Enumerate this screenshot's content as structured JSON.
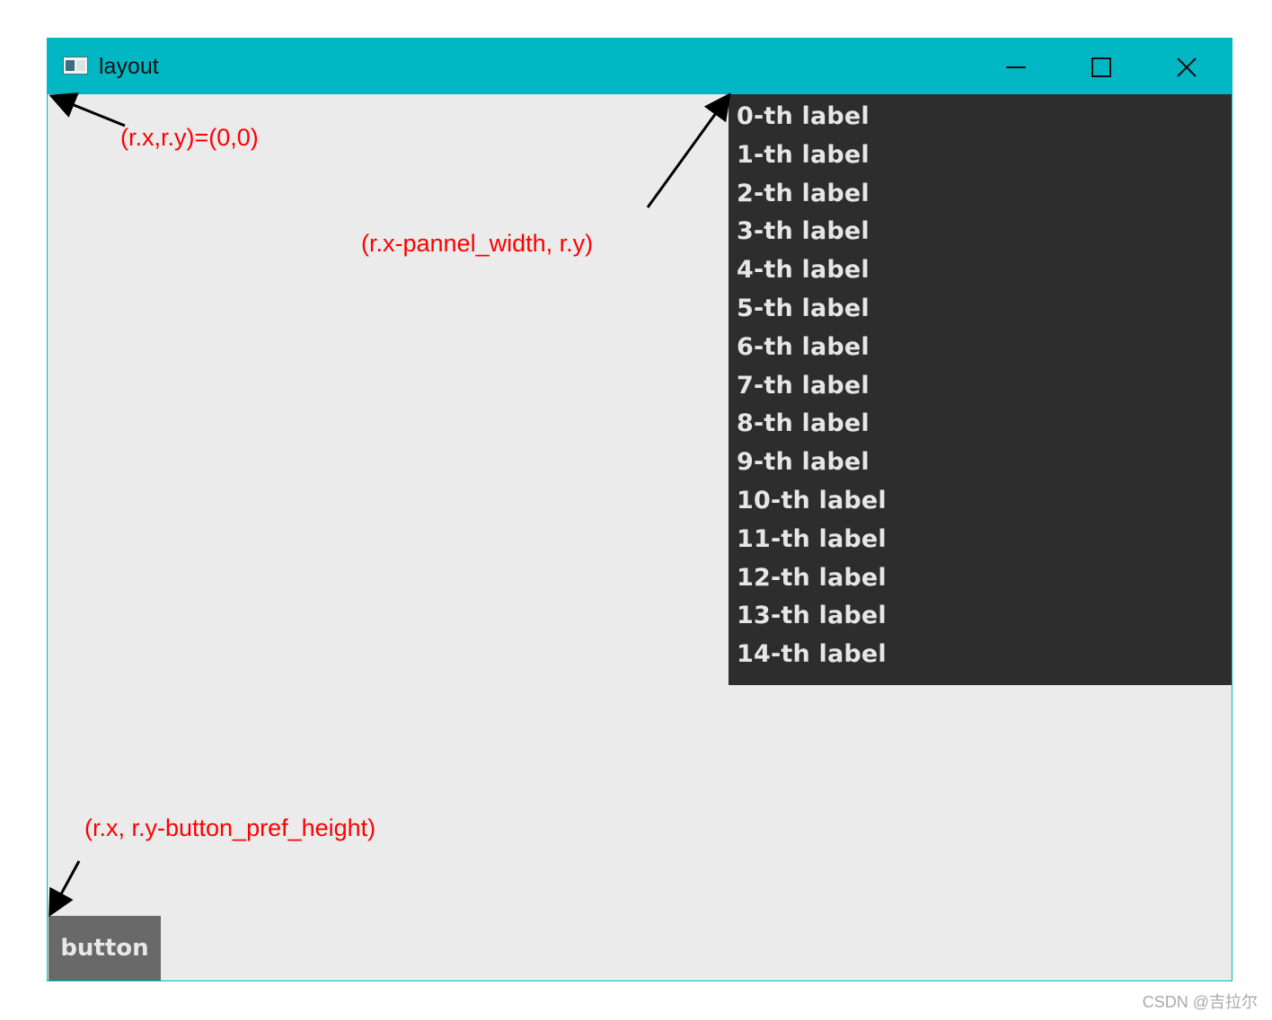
{
  "window": {
    "title": "layout",
    "icon": "app-window-icon",
    "controls": [
      "minimize-icon",
      "maximize-icon",
      "close-icon"
    ]
  },
  "panel": {
    "labels": [
      "0-th label",
      "1-th label",
      "2-th label",
      "3-th label",
      "4-th label",
      "5-th label",
      "6-th label",
      "7-th label",
      "8-th label",
      "9-th label",
      "10-th label",
      "11-th label",
      "12-th label",
      "13-th label",
      "14-th label"
    ]
  },
  "button": {
    "label": "button"
  },
  "annotations": {
    "origin": "(r.x,r.y)=(0,0)",
    "panel": "(r.x-pannel_width, r.y)",
    "button": "(r.x, r.y-button_pref_height)"
  },
  "watermark": "CSDN @吉拉尔",
  "colors": {
    "titlebar": "#00b7c3",
    "client": "#ebebeb",
    "panel": "#2d2d2d",
    "button": "#696969",
    "annotation": "#ff0000"
  }
}
